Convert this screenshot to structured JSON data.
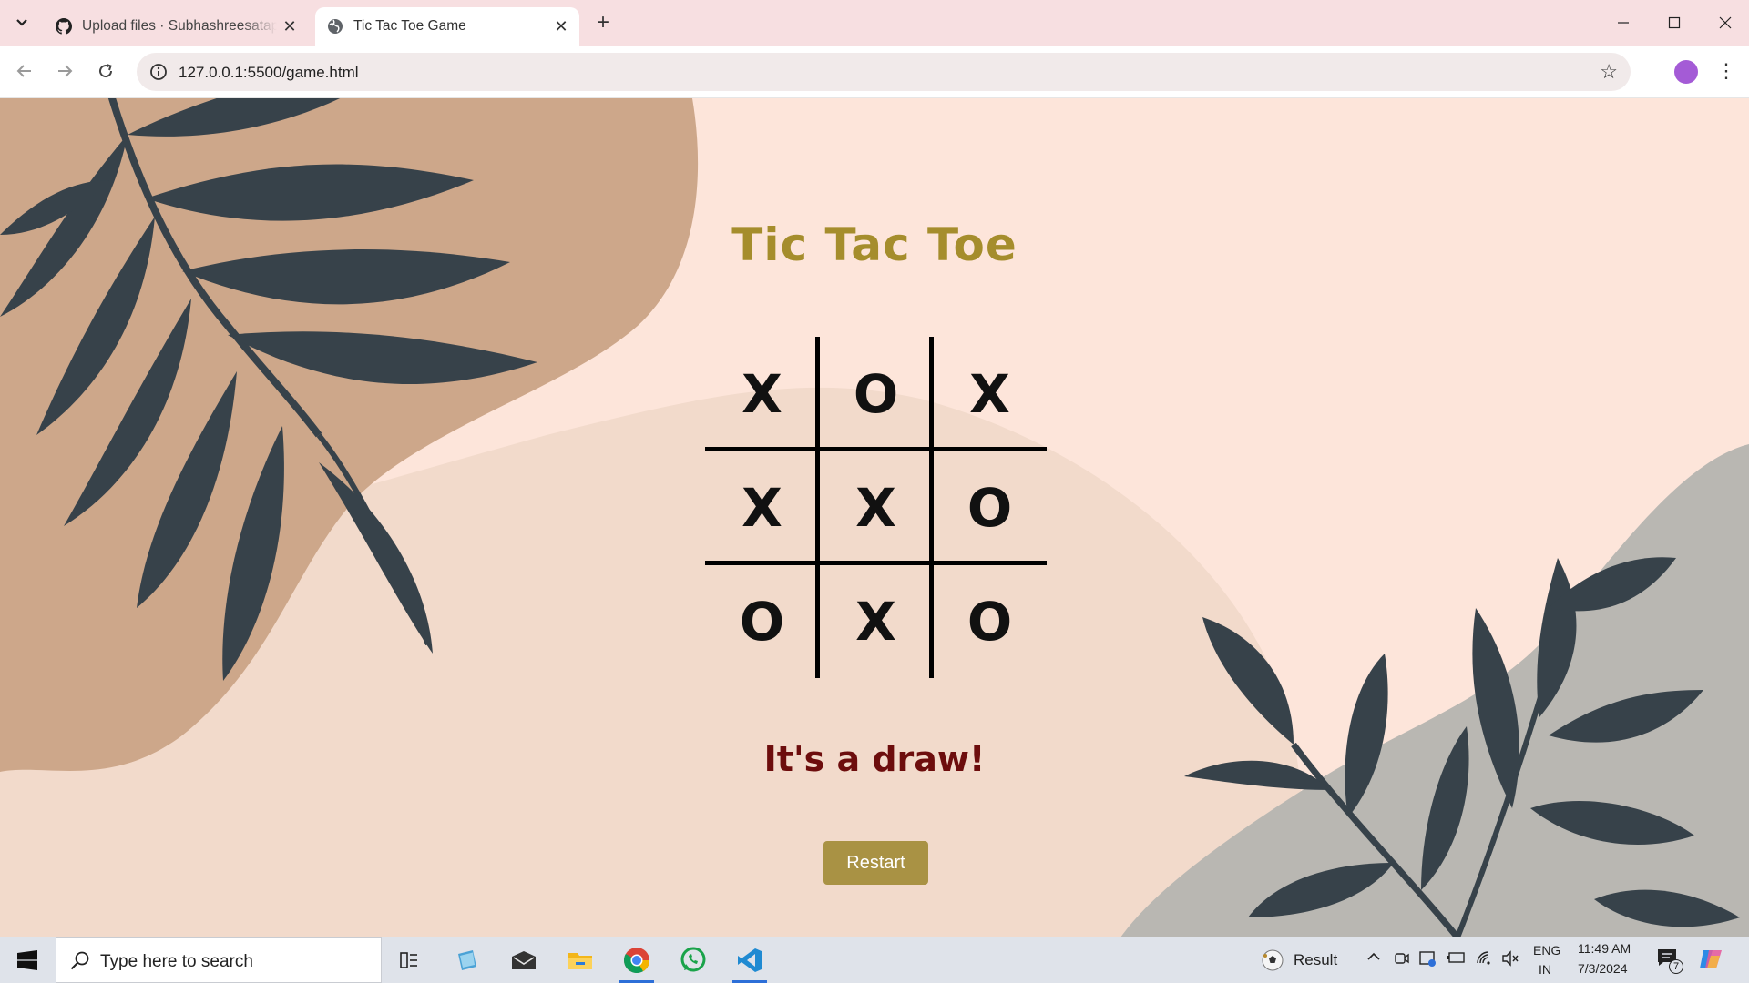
{
  "browser": {
    "tabs": [
      {
        "title": "Upload files · Subhashreesatapathy",
        "icon": "github-icon",
        "active": false
      },
      {
        "title": "Tic Tac Toe Game",
        "icon": "globe-icon",
        "active": true
      }
    ],
    "url": "127.0.0.1:5500/game.html"
  },
  "game": {
    "title": "Tic Tac Toe",
    "board": [
      "X",
      "O",
      "X",
      "X",
      "X",
      "O",
      "O",
      "X",
      "O"
    ],
    "status": "It's a draw!",
    "restart_label": "Restart"
  },
  "colors": {
    "page_bg": "#fde5da",
    "title": "#a58d2c",
    "status": "#6d0d0d",
    "button": "#a99244",
    "leaf": "#37424a",
    "blob_tan": "#cda78a",
    "blob_gray": "#b9b7b2"
  },
  "taskbar": {
    "search_placeholder": "Type here to search",
    "weather_label": "Result",
    "lang_top": "ENG",
    "lang_bottom": "IN",
    "time": "11:49 AM",
    "date": "7/3/2024",
    "notification_count": "7"
  }
}
